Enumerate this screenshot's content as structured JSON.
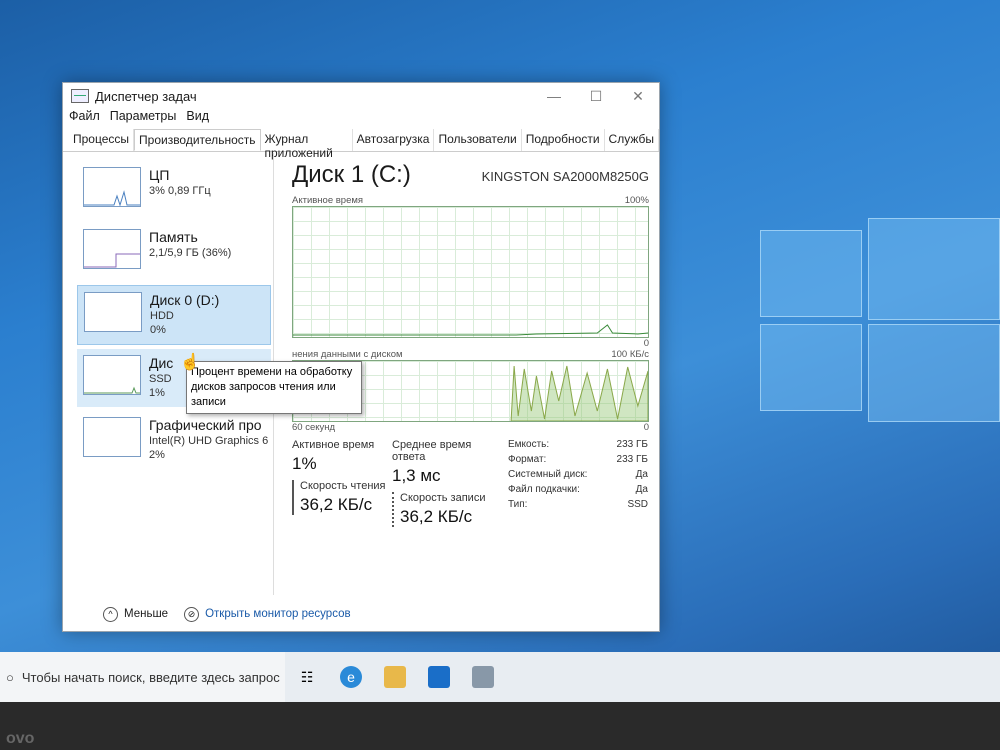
{
  "window": {
    "title": "Диспетчер задач",
    "min": "—",
    "max": "☐",
    "close": "✕"
  },
  "menu": [
    "Файл",
    "Параметры",
    "Вид"
  ],
  "tabs": [
    "Процессы",
    "Производительность",
    "Журнал приложений",
    "Автозагрузка",
    "Пользователи",
    "Подробности",
    "Службы"
  ],
  "active_tab": "Производительность",
  "sidebar": [
    {
      "name": "ЦП",
      "sub1": "3% 0,89 ГГц",
      "sub2": ""
    },
    {
      "name": "Память",
      "sub1": "2,1/5,9 ГБ (36%)",
      "sub2": ""
    },
    {
      "name": "Диск 0 (D:)",
      "sub1": "HDD",
      "sub2": "0%"
    },
    {
      "name": "Дис",
      "sub1": "SSD",
      "sub2": "1%"
    },
    {
      "name": "Графический про",
      "sub1": "Intel(R) UHD Graphics 6",
      "sub2": "2%"
    }
  ],
  "disk": {
    "title": "Диск 1 (C:)",
    "model": "KINGSTON SA2000M8250G",
    "graph1_label": "Активное время",
    "graph1_max": "100%",
    "graph1_min": "0",
    "graph2_label": "нения данными с диском",
    "graph2_max": "100 КБ/с",
    "graph2_min": "0",
    "time_span": "60 секунд",
    "active_label": "Активное время",
    "active_value": "1%",
    "resp_label": "Среднее время ответа",
    "resp_value": "1,3 мс",
    "read_label": "Скорость чтения",
    "read_value": "36,2 КБ/с",
    "write_label": "Скорость записи",
    "write_value": "36,2 КБ/с",
    "props": [
      {
        "k": "Емкость:",
        "v": "233 ГБ"
      },
      {
        "k": "Формат:",
        "v": "233 ГБ"
      },
      {
        "k": "Системный диск:",
        "v": "Да"
      },
      {
        "k": "Файл подкачки:",
        "v": "Да"
      },
      {
        "k": "Тип:",
        "v": "SSD"
      }
    ]
  },
  "footer": {
    "less": "Меньше",
    "monitor": "Открыть монитор ресурсов"
  },
  "tooltip": "Процент времени на обработку дисков запросов чтения или записи",
  "taskbar": {
    "search_placeholder": "Чтобы начать поиск, введите здесь запрос"
  },
  "brand": "ovo"
}
